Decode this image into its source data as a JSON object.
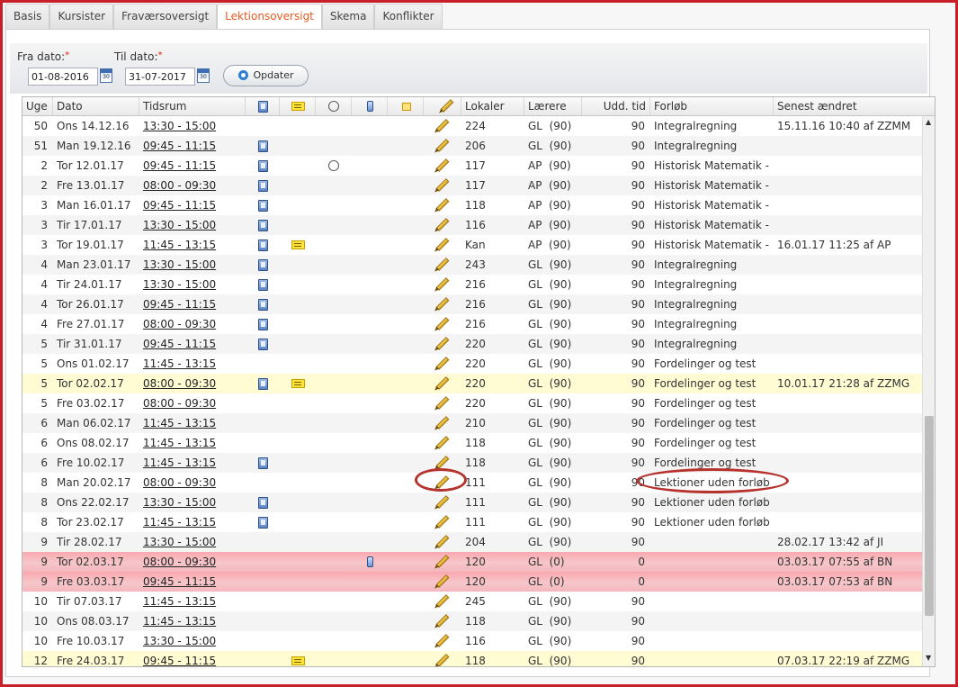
{
  "tabs": [
    {
      "label": "Basis",
      "active": false
    },
    {
      "label": "Kursister",
      "active": false
    },
    {
      "label": "Fraværsoversigt",
      "active": false
    },
    {
      "label": "Lektionsoversigt",
      "active": true
    },
    {
      "label": "Skema",
      "active": false
    },
    {
      "label": "Konflikter",
      "active": false
    }
  ],
  "filter": {
    "fra_label": "Fra dato:",
    "til_label": "Til dato:",
    "required_mark": "*",
    "fra_value": "01-08-2016",
    "til_value": "31-07-2017",
    "calendar_text": "30",
    "update_label": "Opdater"
  },
  "columns": {
    "uge": "Uge",
    "dato": "Dato",
    "tidsrum": "Tidsrum",
    "lokaler": "Lokaler",
    "laerere": "Lærere",
    "udd_tid": "Udd. tid",
    "forloeb": "Forløb",
    "senest": "Senest ændret",
    "icon_columns": [
      "book-icon",
      "note-icon",
      "attachment-icon",
      "phone-icon",
      "image-icon",
      "pencil-icon"
    ]
  },
  "rows": [
    {
      "uge": "50",
      "dato": "Ons 14.12.16",
      "tid": "13:30 - 15:00",
      "book": false,
      "note": false,
      "clip": false,
      "phone": false,
      "lok": "224",
      "laer": "GL  (90)",
      "udd": "90",
      "forl": "Integralregning",
      "senest": "15.11.16 10:40 af ZZMM",
      "style": "normal"
    },
    {
      "uge": "51",
      "dato": "Man 19.12.16",
      "tid": "09:45 - 11:15",
      "book": true,
      "note": false,
      "clip": false,
      "phone": false,
      "lok": "206",
      "laer": "GL  (90)",
      "udd": "90",
      "forl": "Integralregning",
      "senest": "",
      "style": "alt"
    },
    {
      "uge": "2",
      "dato": "Tor 12.01.17",
      "tid": "09:45 - 11:15",
      "book": true,
      "note": false,
      "clip": true,
      "phone": false,
      "lok": "117",
      "laer": "AP  (90)",
      "udd": "90",
      "forl": "Historisk Matematik -",
      "senest": "",
      "style": "normal"
    },
    {
      "uge": "2",
      "dato": "Fre 13.01.17",
      "tid": "08:00 - 09:30",
      "book": true,
      "note": false,
      "clip": false,
      "phone": false,
      "lok": "117",
      "laer": "AP  (90)",
      "udd": "90",
      "forl": "Historisk Matematik -",
      "senest": "",
      "style": "alt"
    },
    {
      "uge": "3",
      "dato": "Man 16.01.17",
      "tid": "09:45 - 11:15",
      "book": true,
      "note": false,
      "clip": false,
      "phone": false,
      "lok": "118",
      "laer": "AP  (90)",
      "udd": "90",
      "forl": "Historisk Matematik -",
      "senest": "",
      "style": "normal"
    },
    {
      "uge": "3",
      "dato": "Tir 17.01.17",
      "tid": "13:30 - 15:00",
      "book": true,
      "note": false,
      "clip": false,
      "phone": false,
      "lok": "116",
      "laer": "AP  (90)",
      "udd": "90",
      "forl": "Historisk Matematik -",
      "senest": "",
      "style": "alt"
    },
    {
      "uge": "3",
      "dato": "Tor 19.01.17",
      "tid": "11:45 - 13:15",
      "book": true,
      "note": true,
      "clip": false,
      "phone": false,
      "lok": "Kan",
      "laer": "AP  (90)",
      "udd": "90",
      "forl": "Historisk Matematik -",
      "senest": "16.01.17 11:25 af AP",
      "style": "normal"
    },
    {
      "uge": "4",
      "dato": "Man 23.01.17",
      "tid": "13:30 - 15:00",
      "book": true,
      "note": false,
      "clip": false,
      "phone": false,
      "lok": "243",
      "laer": "GL  (90)",
      "udd": "90",
      "forl": "Integralregning",
      "senest": "",
      "style": "alt"
    },
    {
      "uge": "4",
      "dato": "Tir 24.01.17",
      "tid": "13:30 - 15:00",
      "book": true,
      "note": false,
      "clip": false,
      "phone": false,
      "lok": "216",
      "laer": "GL  (90)",
      "udd": "90",
      "forl": "Integralregning",
      "senest": "",
      "style": "normal"
    },
    {
      "uge": "4",
      "dato": "Tor 26.01.17",
      "tid": "09:45 - 11:15",
      "book": true,
      "note": false,
      "clip": false,
      "phone": false,
      "lok": "216",
      "laer": "GL  (90)",
      "udd": "90",
      "forl": "Integralregning",
      "senest": "",
      "style": "alt"
    },
    {
      "uge": "4",
      "dato": "Fre 27.01.17",
      "tid": "08:00 - 09:30",
      "book": true,
      "note": false,
      "clip": false,
      "phone": false,
      "lok": "216",
      "laer": "GL  (90)",
      "udd": "90",
      "forl": "Integralregning",
      "senest": "",
      "style": "normal"
    },
    {
      "uge": "5",
      "dato": "Tir 31.01.17",
      "tid": "09:45 - 11:15",
      "book": true,
      "note": false,
      "clip": false,
      "phone": false,
      "lok": "220",
      "laer": "GL  (90)",
      "udd": "90",
      "forl": "Integralregning",
      "senest": "",
      "style": "alt"
    },
    {
      "uge": "5",
      "dato": "Ons 01.02.17",
      "tid": "11:45 - 13:15",
      "book": false,
      "note": false,
      "clip": false,
      "phone": false,
      "lok": "220",
      "laer": "GL  (90)",
      "udd": "90",
      "forl": "Fordelinger og test",
      "senest": "",
      "style": "normal"
    },
    {
      "uge": "5",
      "dato": "Tor 02.02.17",
      "tid": "08:00 - 09:30",
      "book": true,
      "note": true,
      "clip": false,
      "phone": false,
      "lok": "220",
      "laer": "GL  (90)",
      "udd": "90",
      "forl": "Fordelinger og test",
      "senest": "10.01.17 21:28 af ZZMG",
      "style": "hl"
    },
    {
      "uge": "5",
      "dato": "Fre 03.02.17",
      "tid": "08:00 - 09:30",
      "book": false,
      "note": false,
      "clip": false,
      "phone": false,
      "lok": "220",
      "laer": "GL  (90)",
      "udd": "90",
      "forl": "Fordelinger og test",
      "senest": "",
      "style": "normal"
    },
    {
      "uge": "6",
      "dato": "Man 06.02.17",
      "tid": "11:45 - 13:15",
      "book": false,
      "note": false,
      "clip": false,
      "phone": false,
      "lok": "210",
      "laer": "GL  (90)",
      "udd": "90",
      "forl": "Fordelinger og test",
      "senest": "",
      "style": "alt"
    },
    {
      "uge": "6",
      "dato": "Ons 08.02.17",
      "tid": "11:45 - 13:15",
      "book": false,
      "note": false,
      "clip": false,
      "phone": false,
      "lok": "118",
      "laer": "GL  (90)",
      "udd": "90",
      "forl": "Fordelinger og test",
      "senest": "",
      "style": "normal"
    },
    {
      "uge": "6",
      "dato": "Fre 10.02.17",
      "tid": "11:45 - 13:15",
      "book": true,
      "note": false,
      "clip": false,
      "phone": false,
      "lok": "118",
      "laer": "GL  (90)",
      "udd": "90",
      "forl": "Fordelinger og test",
      "senest": "",
      "style": "alt"
    },
    {
      "uge": "8",
      "dato": "Man 20.02.17",
      "tid": "08:00 - 09:30",
      "book": false,
      "note": false,
      "clip": false,
      "phone": false,
      "lok": "111",
      "laer": "GL  (90)",
      "udd": "90",
      "forl": "Lektioner uden forløb",
      "senest": "",
      "style": "normal"
    },
    {
      "uge": "8",
      "dato": "Ons 22.02.17",
      "tid": "13:30 - 15:00",
      "book": true,
      "note": false,
      "clip": false,
      "phone": false,
      "lok": "111",
      "laer": "GL  (90)",
      "udd": "90",
      "forl": "Lektioner uden forløb",
      "senest": "",
      "style": "alt"
    },
    {
      "uge": "8",
      "dato": "Tor 23.02.17",
      "tid": "11:45 - 13:15",
      "book": true,
      "note": false,
      "clip": false,
      "phone": false,
      "lok": "111",
      "laer": "GL  (90)",
      "udd": "90",
      "forl": "Lektioner uden forløb",
      "senest": "",
      "style": "normal"
    },
    {
      "uge": "9",
      "dato": "Tir 28.02.17",
      "tid": "13:30 - 15:00",
      "book": false,
      "note": false,
      "clip": false,
      "phone": false,
      "lok": "204",
      "laer": "GL  (90)",
      "udd": "90",
      "forl": "",
      "senest": "28.02.17 13:42 af JI",
      "style": "alt"
    },
    {
      "uge": "9",
      "dato": "Tor 02.03.17",
      "tid": "08:00 - 09:30",
      "book": false,
      "note": false,
      "clip": false,
      "phone": true,
      "lok": "120",
      "laer": "GL  (0)",
      "udd": "0",
      "forl": "",
      "senest": "03.03.17 07:55 af BN",
      "style": "red"
    },
    {
      "uge": "9",
      "dato": "Fre 03.03.17",
      "tid": "09:45 - 11:15",
      "book": false,
      "note": false,
      "clip": false,
      "phone": false,
      "lok": "120",
      "laer": "GL  (0)",
      "udd": "0",
      "forl": "",
      "senest": "03.03.17 07:53 af BN",
      "style": "red"
    },
    {
      "uge": "10",
      "dato": "Tir 07.03.17",
      "tid": "11:45 - 13:15",
      "book": false,
      "note": false,
      "clip": false,
      "phone": false,
      "lok": "245",
      "laer": "GL  (90)",
      "udd": "90",
      "forl": "",
      "senest": "",
      "style": "normal"
    },
    {
      "uge": "10",
      "dato": "Ons 08.03.17",
      "tid": "11:45 - 13:15",
      "book": false,
      "note": false,
      "clip": false,
      "phone": false,
      "lok": "118",
      "laer": "GL  (90)",
      "udd": "90",
      "forl": "",
      "senest": "",
      "style": "alt"
    },
    {
      "uge": "10",
      "dato": "Fre 10.03.17",
      "tid": "13:30 - 15:00",
      "book": false,
      "note": false,
      "clip": false,
      "phone": false,
      "lok": "116",
      "laer": "GL  (90)",
      "udd": "90",
      "forl": "",
      "senest": "",
      "style": "normal"
    },
    {
      "uge": "12",
      "dato": "Fre 24.03.17",
      "tid": "09:45 - 11:15",
      "book": false,
      "note": true,
      "clip": false,
      "phone": false,
      "lok": "118",
      "laer": "GL  (90)",
      "udd": "90",
      "forl": "",
      "senest": "07.03.17 22:19 af ZZMG",
      "style": "hl"
    }
  ],
  "scroll": {
    "up_arrow": "▲",
    "down_arrow": "▼"
  },
  "colors": {
    "accent": "#e85a20",
    "highlight_row": "#fffbd3",
    "cancelled_row": "#f6b7bc",
    "annotation": "#b5332c",
    "frame": "#c8202a"
  }
}
